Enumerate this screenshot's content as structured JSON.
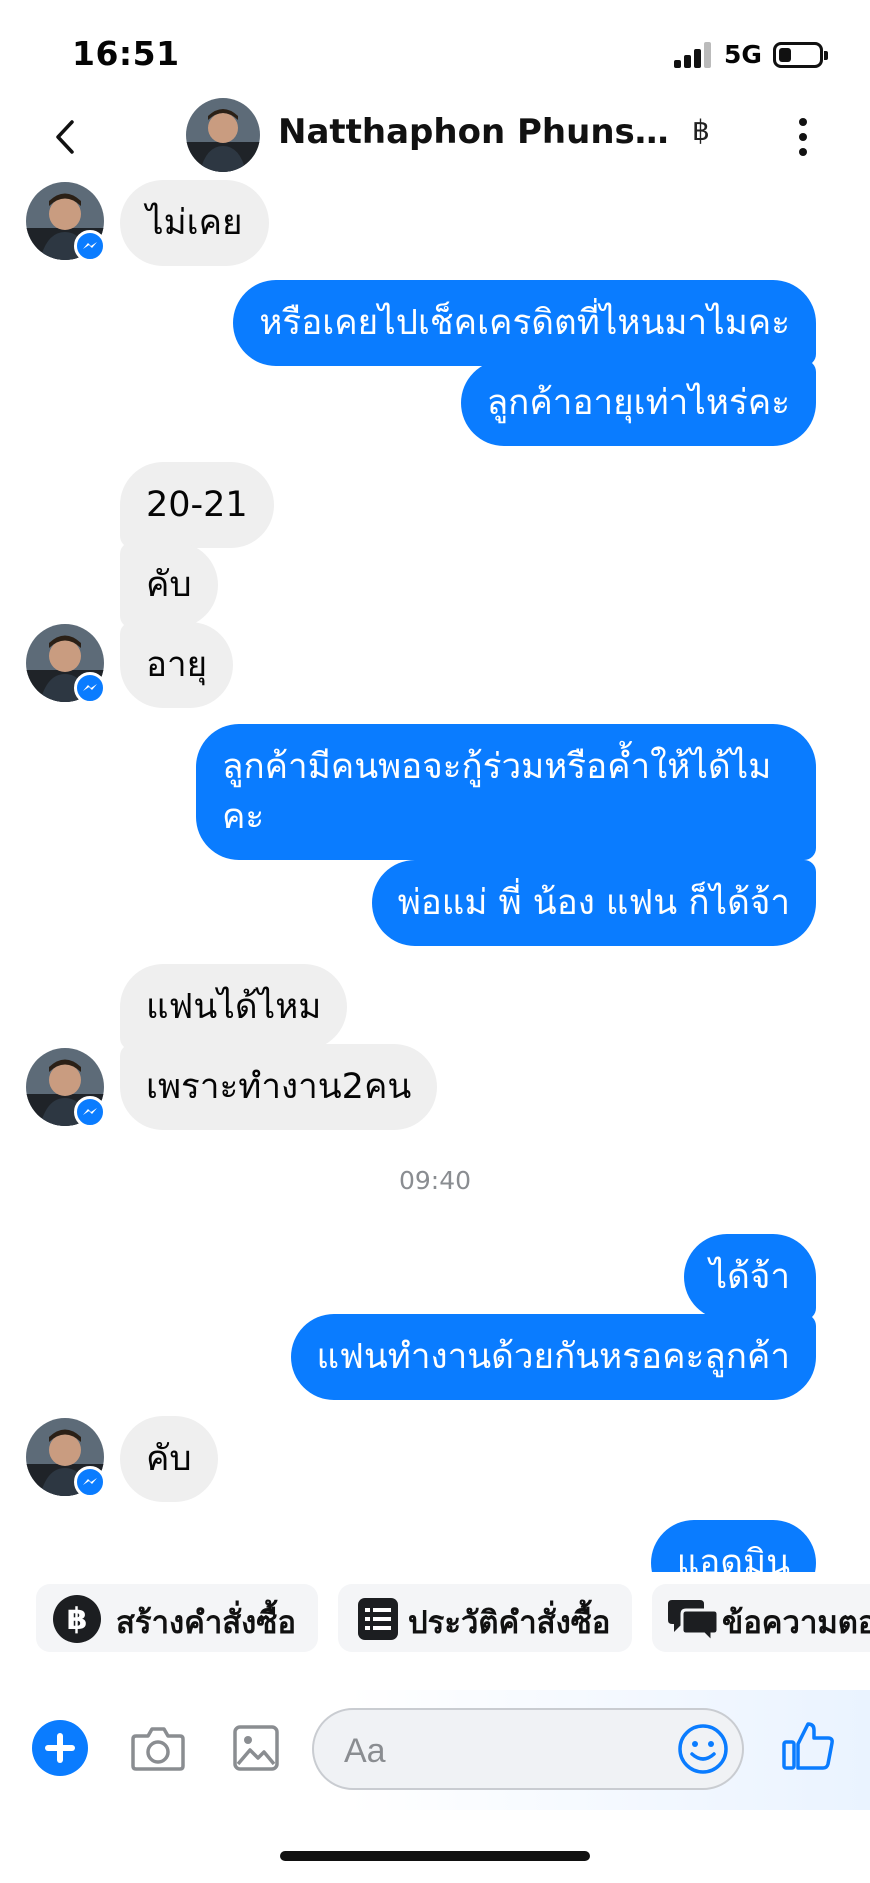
{
  "status_bar": {
    "time": "16:51",
    "network": "5G"
  },
  "header": {
    "contact_name": "Natthaphon Phunsa...",
    "shop_symbol": "฿"
  },
  "messages": [
    {
      "dir": "in",
      "text": "ไม่เคย"
    },
    {
      "dir": "out",
      "text": "หรือเคยไปเช็คเครดิตที่ไหนมาไมคะ"
    },
    {
      "dir": "out",
      "text": "ลูกค้าอายุเท่าไหร่คะ"
    },
    {
      "dir": "in",
      "text": "20-21"
    },
    {
      "dir": "in",
      "text": "คับ"
    },
    {
      "dir": "in",
      "text": "อายุ"
    },
    {
      "dir": "out",
      "text": "ลูกค้ามีคนพอจะกู้ร่วมหรือค้ำให้ได้ไมคะ"
    },
    {
      "dir": "out",
      "text": "พ่อแม่ พี่ น้อง แฟน ก็ได้จ้า"
    },
    {
      "dir": "in",
      "text": "แฟนได้ไหม"
    },
    {
      "dir": "in",
      "text": "เพราะทำงาน2คน"
    },
    {
      "dir": "out",
      "text": "ได้จ้า"
    },
    {
      "dir": "out",
      "text": "แฟนทำงานด้วยกันหรอคะลูกค้า"
    },
    {
      "dir": "in",
      "text": "คับ"
    },
    {
      "dir": "out",
      "text": "แอดมิน"
    }
  ],
  "timestamp": "09:40",
  "quick_actions": [
    {
      "label": "สร้างคำสั่งซื้อ",
      "icon": "baht-circle-icon"
    },
    {
      "label": "ประวัติคำสั่งซื้อ",
      "icon": "order-list-icon"
    },
    {
      "label": "ข้อความตอ",
      "icon": "saved-replies-icon"
    }
  ],
  "composer": {
    "placeholder": "Aa"
  },
  "colors": {
    "accent": "#0a7cff",
    "incoming_bubble": "#efefef"
  }
}
